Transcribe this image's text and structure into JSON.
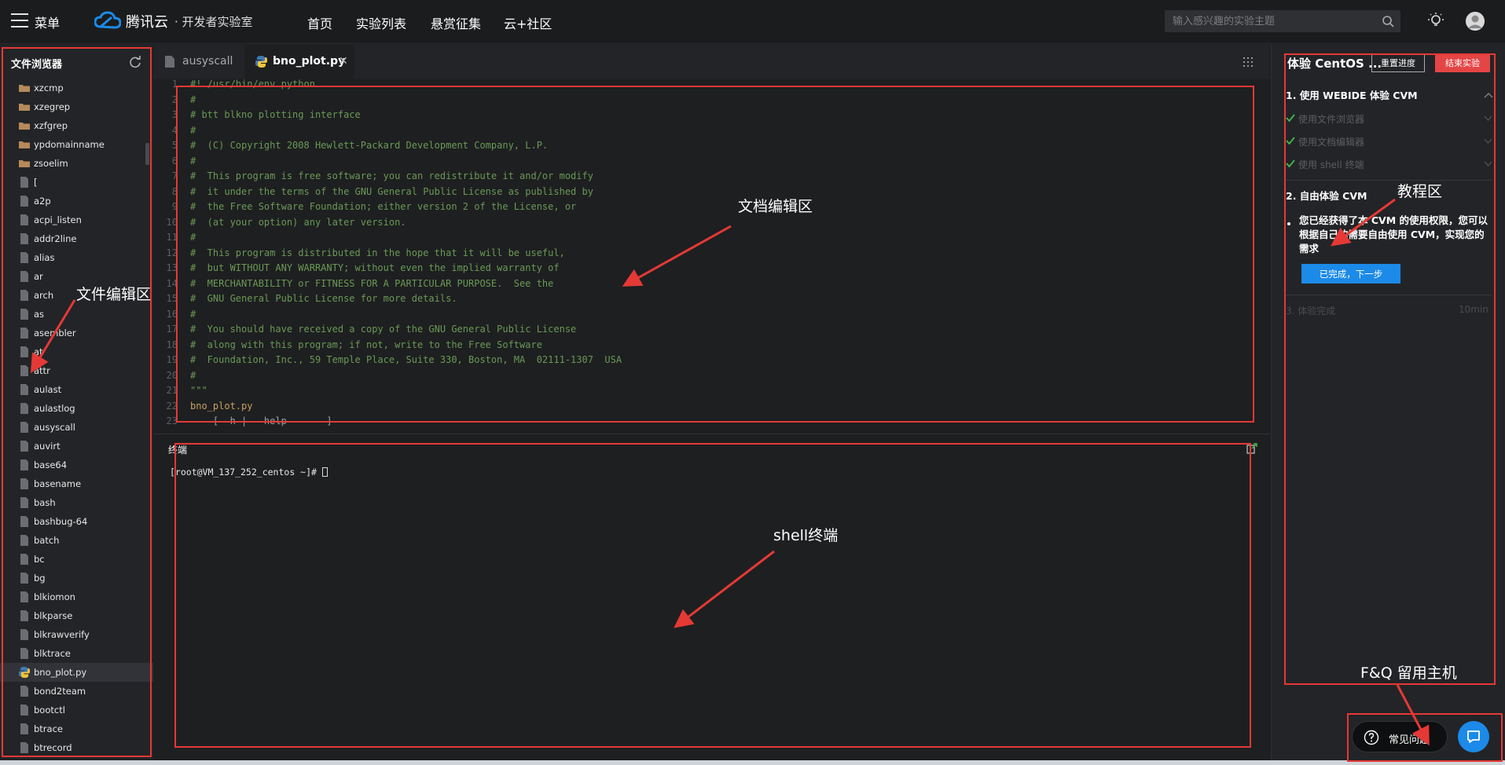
{
  "topnav": {
    "menu_label": "菜单",
    "logo_text": "腾讯云",
    "logo_sub": "· 开发者实验室",
    "nav_items": [
      "首页",
      "实验列表",
      "悬赏征集",
      "云+社区"
    ],
    "search_placeholder": "输入感兴趣的实验主题"
  },
  "file_browser": {
    "title": "文件浏览器",
    "items": [
      {
        "name": "xzcmp",
        "type": "folder"
      },
      {
        "name": "xzegrep",
        "type": "folder"
      },
      {
        "name": "xzfgrep",
        "type": "folder"
      },
      {
        "name": "ypdomainname",
        "type": "folder"
      },
      {
        "name": "zsoelim",
        "type": "folder"
      },
      {
        "name": "[",
        "type": "file"
      },
      {
        "name": "a2p",
        "type": "file"
      },
      {
        "name": "acpi_listen",
        "type": "file"
      },
      {
        "name": "addr2line",
        "type": "file"
      },
      {
        "name": "alias",
        "type": "file"
      },
      {
        "name": "ar",
        "type": "file"
      },
      {
        "name": "arch",
        "type": "file"
      },
      {
        "name": "as",
        "type": "file"
      },
      {
        "name": "asembler",
        "type": "file"
      },
      {
        "name": "at",
        "type": "file"
      },
      {
        "name": "attr",
        "type": "file"
      },
      {
        "name": "aulast",
        "type": "file"
      },
      {
        "name": "aulastlog",
        "type": "file"
      },
      {
        "name": "ausyscall",
        "type": "file"
      },
      {
        "name": "auvirt",
        "type": "file"
      },
      {
        "name": "base64",
        "type": "file"
      },
      {
        "name": "basename",
        "type": "file"
      },
      {
        "name": "bash",
        "type": "file"
      },
      {
        "name": "bashbug-64",
        "type": "file"
      },
      {
        "name": "batch",
        "type": "file"
      },
      {
        "name": "bc",
        "type": "file"
      },
      {
        "name": "bg",
        "type": "file"
      },
      {
        "name": "blkiomon",
        "type": "file"
      },
      {
        "name": "blkparse",
        "type": "file"
      },
      {
        "name": "blkrawverify",
        "type": "file"
      },
      {
        "name": "blktrace",
        "type": "file"
      },
      {
        "name": "bno_plot.py",
        "type": "python",
        "selected": true
      },
      {
        "name": "bond2team",
        "type": "file"
      },
      {
        "name": "bootctl",
        "type": "file"
      },
      {
        "name": "btrace",
        "type": "file"
      },
      {
        "name": "btrecord",
        "type": "file"
      }
    ]
  },
  "tabs": [
    {
      "label": "ausyscall",
      "active": false
    },
    {
      "label": "bno_plot.py",
      "active": true
    }
  ],
  "editor": {
    "lines": [
      {
        "n": "1",
        "text": "#! /usr/bin/env python"
      },
      {
        "n": "2",
        "text": "#"
      },
      {
        "n": "3",
        "text": "# btt blkno plotting interface"
      },
      {
        "n": "4",
        "text": "#"
      },
      {
        "n": "5",
        "text": "#  (C) Copyright 2008 Hewlett-Packard Development Company, L.P."
      },
      {
        "n": "6",
        "text": "#"
      },
      {
        "n": "7",
        "text": "#  This program is free software; you can redistribute it and/or modify"
      },
      {
        "n": "8",
        "text": "#  it under the terms of the GNU General Public License as published by"
      },
      {
        "n": "9",
        "text": "#  the Free Software Foundation; either version 2 of the License, or"
      },
      {
        "n": "10",
        "text": "#  (at your option) any later version."
      },
      {
        "n": "11",
        "text": "#"
      },
      {
        "n": "12",
        "text": "#  This program is distributed in the hope that it will be useful,"
      },
      {
        "n": "13",
        "text": "#  but WITHOUT ANY WARRANTY; without even the implied warranty of"
      },
      {
        "n": "14",
        "text": "#  MERCHANTABILITY or FITNESS FOR A PARTICULAR PURPOSE.  See the"
      },
      {
        "n": "15",
        "text": "#  GNU General Public License for more details."
      },
      {
        "n": "16",
        "text": "#"
      },
      {
        "n": "17",
        "text": "#  You should have received a copy of the GNU General Public License"
      },
      {
        "n": "18",
        "text": "#  along with this program; if not, write to the Free Software"
      },
      {
        "n": "19",
        "text": "#  Foundation, Inc., 59 Temple Place, Suite 330, Boston, MA  02111-1307  USA"
      },
      {
        "n": "20",
        "text": "#"
      },
      {
        "n": "21",
        "text": "\"\"\""
      },
      {
        "n": "22",
        "text": "bno_plot.py"
      },
      {
        "n": "23",
        "text": "    [ -h | --help       ]"
      }
    ]
  },
  "terminal": {
    "title": "终端",
    "prompt": "[root@VM_137_252_centos ~]# "
  },
  "tutorial": {
    "title": "体验 CentOS ...",
    "reset_label": "重置进度",
    "end_label": "结束实验",
    "section1": "1. 使用 WEBIDE 体验 CVM",
    "sub_items": [
      "使用文件浏览器",
      "使用文档编辑器",
      "使用 shell 终端"
    ],
    "section2": "2. 自由体验 CVM",
    "desc": "您已经获得了本 CVM 的使用权限，您可以根据自己的需要自由使用 CVM，实现您的需求",
    "next_label": "已完成，下一步",
    "section3": "3. 体验完成",
    "section3_time": "10min"
  },
  "annotations": {
    "file_area": "文件编辑区",
    "doc_area": "文档编辑区",
    "tutorial_area": "教程区",
    "shell_area": "shell终端",
    "faq_area": "F&Q 留用主机"
  },
  "faq": {
    "label": "常见问题"
  },
  "colors": {
    "accent": "#1c8ae8",
    "danger": "#e54545",
    "annotation": "#e53935",
    "comment": "#6a9955"
  }
}
